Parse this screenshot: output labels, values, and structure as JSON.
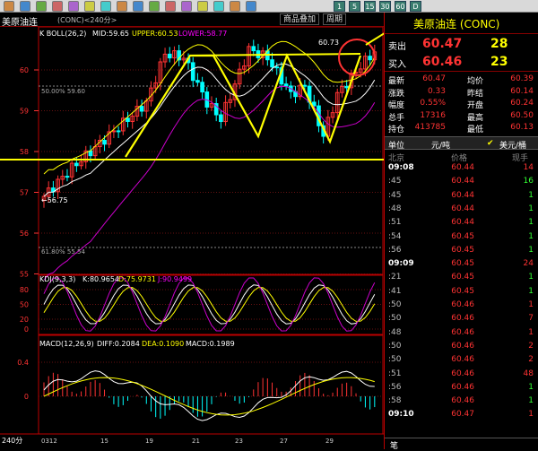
{
  "toolbar": {
    "icons": [
      "back-icon",
      "forward-icon",
      "home-icon",
      "quote-icon",
      "report-icon",
      "chart-icon",
      "minute-icon",
      "kline-icon",
      "draw-icon",
      "info-icon",
      "news-icon",
      "f10-icon",
      "search-icon",
      "print-icon",
      "tools-icon",
      "help-icon"
    ],
    "periods": [
      "1",
      "5",
      "15",
      "30",
      "60",
      "D"
    ],
    "colors": [
      "#c84",
      "#48c",
      "#6a4",
      "#c66",
      "#a6c",
      "#cc4",
      "#4cc",
      "#c84",
      "#48c",
      "#6a4",
      "#c66",
      "#a6c",
      "#cc4",
      "#4cc",
      "#c84",
      "#48c"
    ]
  },
  "title": {
    "name": "美原油连",
    "code": "(CONC)<240分>",
    "btn_overlay": "商品叠加",
    "btn_cycle": "周期"
  },
  "main": {
    "indicator": "K  BOLL(26,2)",
    "mid": "MID:59.65",
    "upper": "UPPER:60.53",
    "lower": "LOWER:58.77",
    "fib50": "50.00% 59.60",
    "fib618": "61.80% 55.54",
    "high_label": "60.73",
    "low_label": "←56.75",
    "y_labels": [
      "60",
      "59",
      "58",
      "57",
      "56",
      "55"
    ]
  },
  "kdj": {
    "label": "KDJ(9,3,3)",
    "k": "K:80.9654",
    "d": "D:75.9731",
    "j": "J:90.9499",
    "y_labels": [
      "80",
      "50",
      "20",
      "0"
    ]
  },
  "macd": {
    "label": "MACD(12,26,9)",
    "diff": "DIFF:0.2084",
    "dea": "DEA:0.1090",
    "macd": "MACD:0.1989",
    "y_labels": [
      "0.4",
      "0"
    ]
  },
  "xaxis": {
    "period": "240分",
    "labels": [
      "0312",
      "15",
      "19",
      "21",
      "23",
      "27",
      "29"
    ]
  },
  "right": {
    "title": "美原油连 (CONC)",
    "sell_label": "卖出",
    "sell_price": "60.47",
    "sell_vol": "28",
    "buy_label": "买入",
    "buy_price": "60.46",
    "buy_vol": "23",
    "stats": [
      {
        "l": "最新",
        "v1": "60.47",
        "l2": "均价",
        "v2": "60.39"
      },
      {
        "l": "涨跌",
        "v1": "0.33",
        "l2": "昨结",
        "v2": "60.14"
      },
      {
        "l": "幅度",
        "v1": "0.55%",
        "l2": "开盘",
        "v2": "60.24"
      },
      {
        "l": "总手",
        "v1": "17316",
        "l2": "最高",
        "v2": "60.50"
      },
      {
        "l": "持仓",
        "v1": "413785",
        "l2": "最低",
        "v2": "60.13"
      }
    ],
    "unit_label": "单位",
    "unit_value": "元/吨",
    "unit_option": "美元/桶",
    "head_place": "北京",
    "head_price": "价格",
    "head_vol": "现手",
    "ticks": [
      {
        "t": "09:08",
        "p": "60.44",
        "v": "14",
        "c": "#f33"
      },
      {
        "t": ":45",
        "p": "60.44",
        "v": "16",
        "c": "#3f3"
      },
      {
        "t": ":45",
        "p": "60.44",
        "v": "1",
        "c": "#3f3"
      },
      {
        "t": ":48",
        "p": "60.44",
        "v": "1",
        "c": "#3f3"
      },
      {
        "t": ":51",
        "p": "60.44",
        "v": "1",
        "c": "#3f3"
      },
      {
        "t": ":54",
        "p": "60.45",
        "v": "1",
        "c": "#3f3"
      },
      {
        "t": ":56",
        "p": "60.45",
        "v": "1",
        "c": "#3f3"
      },
      {
        "t": "09:09",
        "p": "60.45",
        "v": "24",
        "c": "#f33"
      },
      {
        "t": ":21",
        "p": "60.45",
        "v": "1",
        "c": "#3f3"
      },
      {
        "t": ":41",
        "p": "60.45",
        "v": "1",
        "c": "#3f3"
      },
      {
        "t": ":50",
        "p": "60.46",
        "v": "1",
        "c": "#f33"
      },
      {
        "t": ":50",
        "p": "60.46",
        "v": "7",
        "c": "#f33"
      },
      {
        "t": ":48",
        "p": "60.46",
        "v": "1",
        "c": "#f33"
      },
      {
        "t": ":50",
        "p": "60.46",
        "v": "2",
        "c": "#f33"
      },
      {
        "t": ":50",
        "p": "60.46",
        "v": "2",
        "c": "#f33"
      },
      {
        "t": ":51",
        "p": "60.46",
        "v": "48",
        "c": "#f33"
      },
      {
        "t": ":56",
        "p": "60.46",
        "v": "1",
        "c": "#3f3"
      },
      {
        "t": ":58",
        "p": "60.46",
        "v": "1",
        "c": "#3f3"
      },
      {
        "t": "09:10",
        "p": "60.47",
        "v": "1",
        "c": "#f33"
      }
    ],
    "footer": "笔"
  }
}
